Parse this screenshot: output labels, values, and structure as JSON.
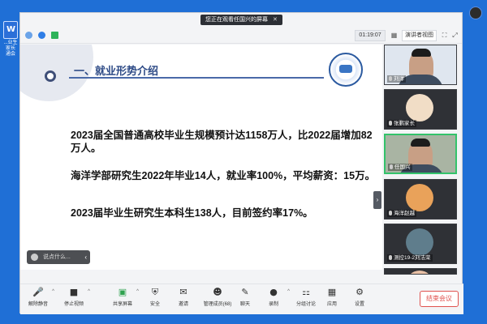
{
  "desktop": {
    "icon_label_line1": "...业生家长",
    "icon_label_line2": "通会"
  },
  "share_banner": {
    "text": "您正在观看任国兴的屏幕",
    "close": "✕"
  },
  "top_bar": {
    "timer": "01:19:07",
    "layout_button": "演讲者视图"
  },
  "slide": {
    "title": "一、就业形势介绍",
    "paragraphs": [
      "2023届全国普通高校毕业生规模预计达1158万人，比2022届增加82万人。",
      "海洋学部研究生2022年毕业14人，就业率100%，平均薪资：15万。",
      "2023届毕业生研究生本科生138人，目前签约率17%。"
    ]
  },
  "comment_box": {
    "placeholder": "说点什么...",
    "chevron": "‹"
  },
  "collapse_arrow": "›",
  "participants": [
    {
      "name": "刘洋"
    },
    {
      "name": "张鹏家长"
    },
    {
      "name": "任国兴"
    },
    {
      "name": "海洋赵越"
    },
    {
      "name": "测控19-2刘洁荣"
    },
    {
      "name": ""
    }
  ],
  "toolbar": {
    "items": [
      {
        "label": "解除静音",
        "icon": "🎤"
      },
      {
        "label": "停止视频",
        "icon": "■"
      },
      {
        "label": "共享屏幕",
        "icon": "▣"
      },
      {
        "label": "安全",
        "icon": "⛨"
      },
      {
        "label": "邀请",
        "icon": "✉"
      },
      {
        "label": "管理成员(68)",
        "icon": "☻"
      },
      {
        "label": "聊天",
        "icon": "✎"
      },
      {
        "label": "录制",
        "icon": "●"
      },
      {
        "label": "分组讨论",
        "icon": "⚏"
      },
      {
        "label": "应用",
        "icon": "▦"
      },
      {
        "label": "设置",
        "icon": "⚙"
      }
    ],
    "end_button": "结束会议"
  },
  "colors": {
    "desktop_bg": "#1f6fd6",
    "slide_title": "#2d4a86",
    "active_speaker": "#33c36b",
    "end_meeting": "#e0524f"
  }
}
